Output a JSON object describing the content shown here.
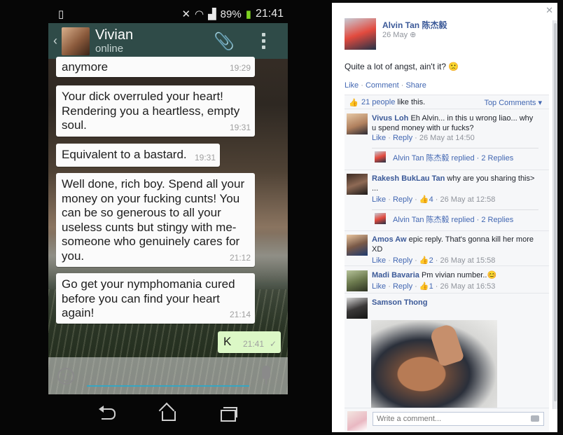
{
  "phone": {
    "status": {
      "battery": "89%",
      "time": "21:41"
    },
    "chat_header": {
      "name": "Vivian",
      "presence": "online"
    },
    "messages": [
      {
        "text": "anymore",
        "time": "19:29"
      },
      {
        "text": "Your dick overruled your heart! Rendering you a heartless, empty soul.",
        "time": "19:31"
      },
      {
        "text": "Equivalent to a bastard.",
        "time": "19:31"
      },
      {
        "text": "Well done, rich boy. Spend all your money on your fucking cunts! You can be so generous to all your useless cunts but stingy with me- someone who genuinely cares for you.",
        "time": "21:12"
      },
      {
        "text": "Go get your nymphomania cured before you can find your heart again!",
        "time": "21:14"
      },
      {
        "text": "K",
        "time": "21:41"
      }
    ]
  },
  "facebook": {
    "post": {
      "author": "Alvin Tan 陈杰毅",
      "date": "26 May",
      "text": "Quite a lot of angst, ain't it? 🙁",
      "actions": {
        "like": "Like",
        "comment": "Comment",
        "share": "Share"
      }
    },
    "likes": {
      "count_link": "21 people",
      "suffix": "like this.",
      "sort": "Top Comments ▾"
    },
    "comments": [
      {
        "author": "Vivus Loh",
        "text": "Eh Alvin... in this u wrong liao... why u spend money with ur fucks?",
        "like": "Like",
        "reply": "Reply",
        "likes": "",
        "date": "26 May at 14:50",
        "replies": "Alvin Tan 陈杰毅 replied · 2 Replies"
      },
      {
        "author": "Rakesh BukLau Tan",
        "text": "why are you sharing this> ...",
        "like": "Like",
        "reply": "Reply",
        "likes": "4",
        "date": "26 May at 12:58",
        "replies": "Alvin Tan 陈杰毅 replied · 2 Replies"
      },
      {
        "author": "Amos Aw",
        "text": "epic reply. That's gonna kill her more XD",
        "like": "Like",
        "reply": "Reply",
        "likes": "2",
        "date": "26 May at 15:58"
      },
      {
        "author": "Madi Bavaria",
        "text": "Pm vivian number..😊",
        "like": "Like",
        "reply": "Reply",
        "likes": "1",
        "date": "26 May at 16:53"
      },
      {
        "author": "Samson Thong",
        "text": ""
      }
    ],
    "composer": {
      "placeholder": "Write a comment..."
    }
  }
}
